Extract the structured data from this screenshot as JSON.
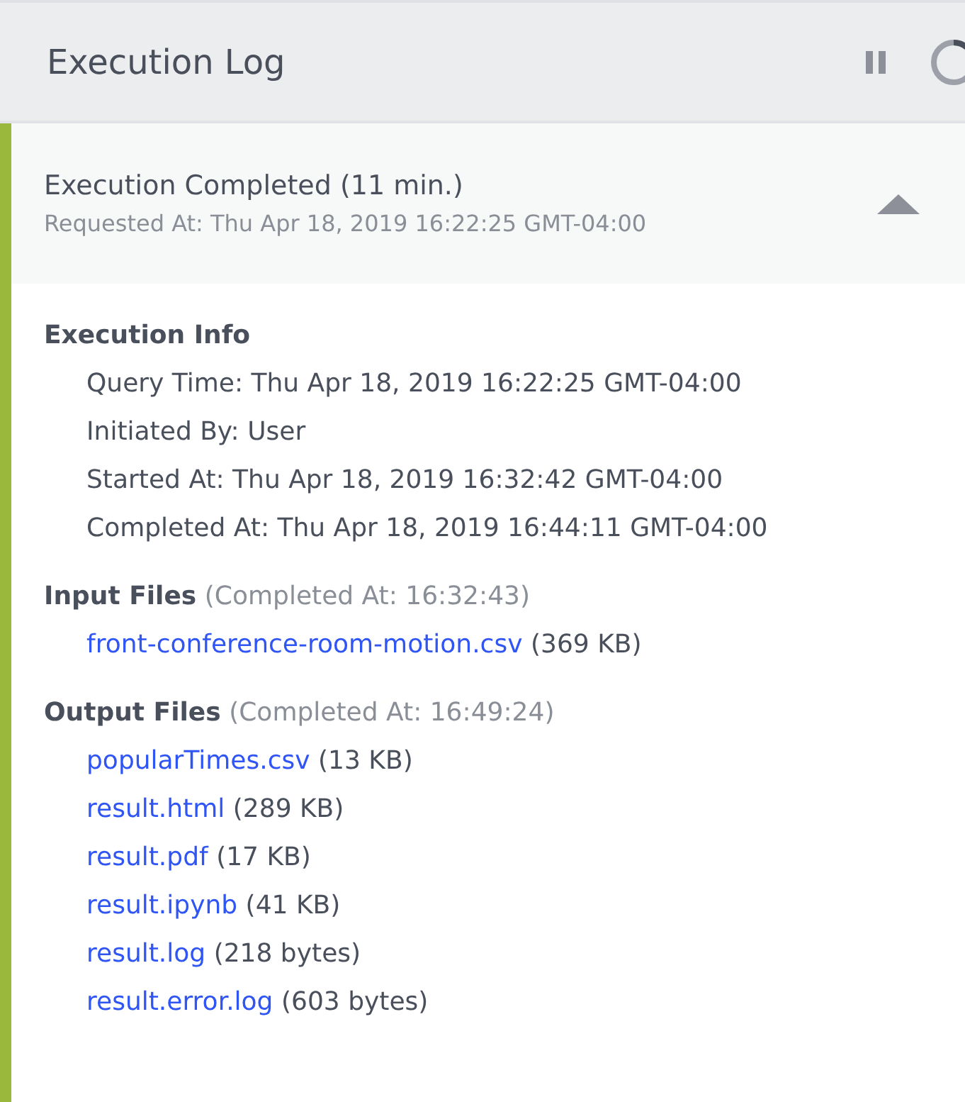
{
  "header": {
    "title": "Execution Log"
  },
  "execution": {
    "status": "Execution Completed (11 min.)",
    "requested": "Requested At: Thu Apr 18, 2019 16:22:25 GMT-04:00",
    "expanded": true,
    "info": {
      "heading": "Execution Info",
      "lines": [
        "Query Time: Thu Apr 18, 2019 16:22:25 GMT-04:00",
        "Initiated By: User",
        "Started At: Thu Apr 18, 2019 16:32:42 GMT-04:00",
        "Completed At: Thu Apr 18, 2019 16:44:11 GMT-04:00"
      ]
    },
    "file_groups": [
      {
        "heading": "Input Files",
        "note": "(Completed At: 16:32:43)",
        "files": [
          {
            "name": "front-conference-room-motion.csv",
            "size": "(369 KB)"
          }
        ]
      },
      {
        "heading": "Output Files",
        "note": "(Completed At: 16:49:24)",
        "files": [
          {
            "name": "popularTimes.csv",
            "size": "(13 KB)"
          },
          {
            "name": "result.html",
            "size": "(289 KB)"
          },
          {
            "name": "result.pdf",
            "size": "(17 KB)"
          },
          {
            "name": "result.ipynb",
            "size": "(41 KB)"
          },
          {
            "name": "result.log",
            "size": "(218 bytes)"
          },
          {
            "name": "result.error.log",
            "size": "(603 bytes)"
          }
        ]
      }
    ]
  }
}
